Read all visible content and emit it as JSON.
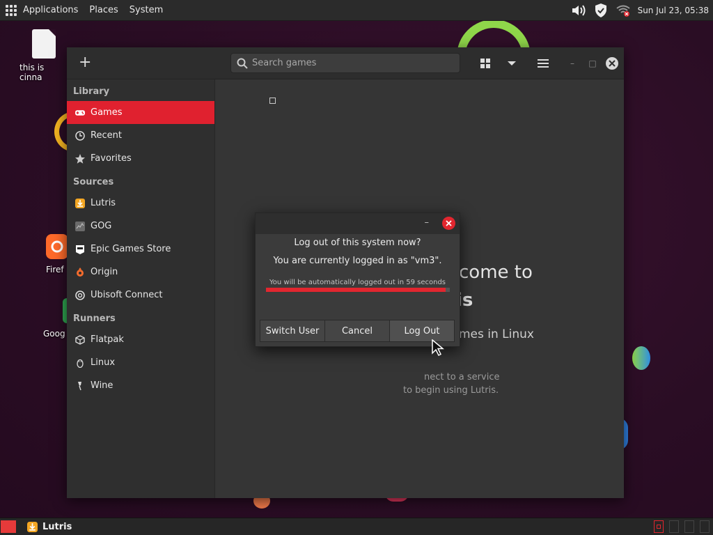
{
  "top_panel": {
    "menus": [
      "Applications",
      "Places",
      "System"
    ],
    "clock": "Sun Jul 23, 05:38"
  },
  "desktop": {
    "icons": [
      {
        "label": "this is cinna"
      },
      {
        "label": "Firef"
      },
      {
        "label": "Goog"
      }
    ]
  },
  "lutris": {
    "search_placeholder": "Search games",
    "sections": {
      "library": "Library",
      "sources": "Sources",
      "runners": "Runners"
    },
    "library_items": [
      "Games",
      "Recent",
      "Favorites"
    ],
    "source_items": [
      "Lutris",
      "GOG",
      "Epic Games Store",
      "Origin",
      "Ubisoft Connect"
    ],
    "runner_items": [
      "Flatpak",
      "Linux",
      "Wine"
    ],
    "welcome": {
      "line1": "come to",
      "line2": "is",
      "line3": "mes in Linux",
      "line4a": "nect to a service",
      "line4b": "to begin using Lutris."
    }
  },
  "dialog": {
    "question": "Log out of this system now?",
    "user_line": "You are currently logged in as \"vm3\".",
    "timer_text": "You will be automatically logged out in 59 seconds",
    "progress": 0.98,
    "buttons": {
      "switch_user": "Switch User",
      "cancel": "Cancel",
      "log_out": "Log Out"
    }
  },
  "taskbar": {
    "app": "Lutris"
  },
  "colors": {
    "accent": "#e0212f",
    "panel": "#2b2b2b",
    "desktop": "#2c0f26"
  }
}
